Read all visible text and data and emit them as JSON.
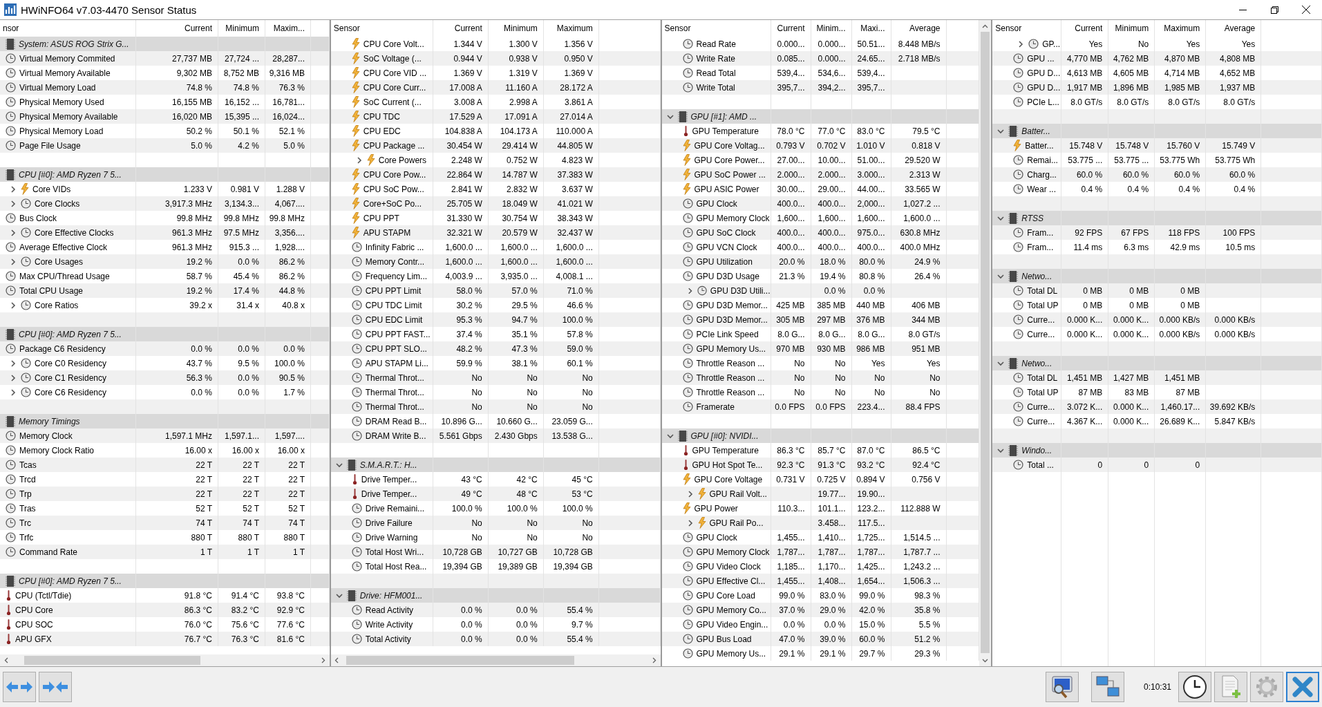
{
  "window": {
    "title": "HWiNFO64 v7.03-4470 Sensor Status"
  },
  "panels": [
    {
      "columns": [
        "nsor",
        "Current",
        "Minimum",
        "Maxim..."
      ],
      "rows": [
        {
          "kind": "group",
          "label": "System: ASUS ROG Strix G..."
        },
        {
          "kind": "clock",
          "label": "Virtual Memory Commited",
          "values": {
            "cur": "27,737 MB",
            "min": "27,724 ...",
            "max": "28,287..."
          }
        },
        {
          "kind": "clock",
          "label": "Virtual Memory Available",
          "values": {
            "cur": "9,302 MB",
            "min": "8,752 MB",
            "max": "9,316 MB"
          }
        },
        {
          "kind": "clock",
          "label": "Virtual Memory Load",
          "values": {
            "cur": "74.8 %",
            "min": "74.8 %",
            "max": "76.3 %"
          }
        },
        {
          "kind": "clock",
          "label": "Physical Memory Used",
          "values": {
            "cur": "16,155 MB",
            "min": "16,152 ...",
            "max": "16,781..."
          }
        },
        {
          "kind": "clock",
          "label": "Physical Memory Available",
          "values": {
            "cur": "16,020 MB",
            "min": "15,395 ...",
            "max": "16,024..."
          }
        },
        {
          "kind": "clock",
          "label": "Physical Memory Load",
          "values": {
            "cur": "50.2 %",
            "min": "50.1 %",
            "max": "52.1 %"
          }
        },
        {
          "kind": "clock",
          "label": "Page File Usage",
          "values": {
            "cur": "5.0 %",
            "min": "4.2 %",
            "max": "5.0 %"
          }
        },
        {
          "kind": "blank"
        },
        {
          "kind": "group",
          "label": "CPU [#0]: AMD Ryzen 7 5..."
        },
        {
          "kind": "bolt",
          "label": "Core VIDs",
          "expanded": false,
          "values": {
            "cur": "1.233 V",
            "min": "0.981 V",
            "max": "1.288 V"
          }
        },
        {
          "kind": "clock",
          "label": "Core Clocks",
          "expanded": false,
          "values": {
            "cur": "3,917.3 MHz",
            "min": "3,134.3...",
            "max": "4,067...."
          }
        },
        {
          "kind": "clock",
          "label": "Bus Clock",
          "values": {
            "cur": "99.8 MHz",
            "min": "99.8 MHz",
            "max": "99.8 MHz"
          }
        },
        {
          "kind": "clock",
          "label": "Core Effective Clocks",
          "expanded": false,
          "values": {
            "cur": "961.3 MHz",
            "min": "97.5 MHz",
            "max": "3,356...."
          }
        },
        {
          "kind": "clock",
          "label": "Average Effective Clock",
          "values": {
            "cur": "961.3 MHz",
            "min": "915.3 ...",
            "max": "1,928...."
          }
        },
        {
          "kind": "clock",
          "label": "Core Usages",
          "expanded": false,
          "values": {
            "cur": "19.2 %",
            "min": "0.0 %",
            "max": "86.2 %"
          }
        },
        {
          "kind": "clock",
          "label": "Max CPU/Thread Usage",
          "values": {
            "cur": "58.7 %",
            "min": "45.4 %",
            "max": "86.2 %"
          }
        },
        {
          "kind": "clock",
          "label": "Total CPU Usage",
          "values": {
            "cur": "19.2 %",
            "min": "17.4 %",
            "max": "44.8 %"
          }
        },
        {
          "kind": "clock",
          "label": "Core Ratios",
          "expanded": false,
          "values": {
            "cur": "39.2 x",
            "min": "31.4 x",
            "max": "40.8 x"
          }
        },
        {
          "kind": "blank"
        },
        {
          "kind": "group",
          "label": "CPU [#0]: AMD Ryzen 7 5..."
        },
        {
          "kind": "clock",
          "label": "Package C6 Residency",
          "values": {
            "cur": "0.0 %",
            "min": "0.0 %",
            "max": "0.0 %"
          }
        },
        {
          "kind": "clock",
          "label": "Core C0 Residency",
          "expanded": false,
          "values": {
            "cur": "43.7 %",
            "min": "9.5 %",
            "max": "100.0 %"
          }
        },
        {
          "kind": "clock",
          "label": "Core C1 Residency",
          "expanded": false,
          "values": {
            "cur": "56.3 %",
            "min": "0.0 %",
            "max": "90.5 %"
          }
        },
        {
          "kind": "clock",
          "label": "Core C6 Residency",
          "expanded": false,
          "values": {
            "cur": "0.0 %",
            "min": "0.0 %",
            "max": "1.7 %"
          }
        },
        {
          "kind": "blank"
        },
        {
          "kind": "group",
          "label": "Memory Timings"
        },
        {
          "kind": "clock",
          "label": "Memory Clock",
          "values": {
            "cur": "1,597.1 MHz",
            "min": "1,597.1...",
            "max": "1,597...."
          }
        },
        {
          "kind": "clock",
          "label": "Memory Clock Ratio",
          "values": {
            "cur": "16.00 x",
            "min": "16.00 x",
            "max": "16.00 x"
          }
        },
        {
          "kind": "clock",
          "label": "Tcas",
          "values": {
            "cur": "22 T",
            "min": "22 T",
            "max": "22 T"
          }
        },
        {
          "kind": "clock",
          "label": "Trcd",
          "values": {
            "cur": "22 T",
            "min": "22 T",
            "max": "22 T"
          }
        },
        {
          "kind": "clock",
          "label": "Trp",
          "values": {
            "cur": "22 T",
            "min": "22 T",
            "max": "22 T"
          }
        },
        {
          "kind": "clock",
          "label": "Tras",
          "values": {
            "cur": "52 T",
            "min": "52 T",
            "max": "52 T"
          }
        },
        {
          "kind": "clock",
          "label": "Trc",
          "values": {
            "cur": "74 T",
            "min": "74 T",
            "max": "74 T"
          }
        },
        {
          "kind": "clock",
          "label": "Trfc",
          "values": {
            "cur": "880 T",
            "min": "880 T",
            "max": "880 T"
          }
        },
        {
          "kind": "clock",
          "label": "Command Rate",
          "values": {
            "cur": "1 T",
            "min": "1 T",
            "max": "1 T"
          }
        },
        {
          "kind": "blank"
        },
        {
          "kind": "group",
          "label": "CPU [#0]: AMD Ryzen 7 5..."
        },
        {
          "kind": "thermometer",
          "label": "CPU (Tctl/Tdie)",
          "values": {
            "cur": "91.8 °C",
            "min": "91.4 °C",
            "max": "93.8 °C"
          }
        },
        {
          "kind": "thermometer",
          "label": "CPU Core",
          "values": {
            "cur": "86.3 °C",
            "min": "83.2 °C",
            "max": "92.9 °C"
          }
        },
        {
          "kind": "thermometer",
          "label": "CPU SOC",
          "values": {
            "cur": "76.0 °C",
            "min": "75.6 °C",
            "max": "77.6 °C"
          }
        },
        {
          "kind": "thermometer",
          "label": "APU GFX",
          "values": {
            "cur": "76.7 °C",
            "min": "76.3 °C",
            "max": "81.6 °C"
          }
        }
      ]
    },
    {
      "columns": [
        "Sensor",
        "Current",
        "Minimum",
        "Maximum"
      ],
      "rows": [
        {
          "kind": "bolt",
          "label": "CPU Core Volt...",
          "values": {
            "cur": "1.344 V",
            "min": "1.300 V",
            "max": "1.356 V"
          }
        },
        {
          "kind": "bolt",
          "label": "SoC Voltage (...",
          "values": {
            "cur": "0.944 V",
            "min": "0.938 V",
            "max": "0.950 V"
          }
        },
        {
          "kind": "bolt",
          "label": "CPU Core VID ...",
          "values": {
            "cur": "1.369 V",
            "min": "1.319 V",
            "max": "1.369 V"
          }
        },
        {
          "kind": "bolt",
          "label": "CPU Core Curr...",
          "values": {
            "cur": "17.008 A",
            "min": "11.160 A",
            "max": "28.172 A"
          }
        },
        {
          "kind": "bolt",
          "label": "SoC Current (...",
          "values": {
            "cur": "3.008 A",
            "min": "2.998 A",
            "max": "3.861 A"
          }
        },
        {
          "kind": "bolt",
          "label": "CPU TDC",
          "values": {
            "cur": "17.529 A",
            "min": "17.091 A",
            "max": "27.014 A"
          }
        },
        {
          "kind": "bolt",
          "label": "CPU EDC",
          "values": {
            "cur": "104.838 A",
            "min": "104.173 A",
            "max": "110.000 A"
          }
        },
        {
          "kind": "bolt",
          "label": "CPU Package ...",
          "values": {
            "cur": "30.454 W",
            "min": "29.414 W",
            "max": "44.805 W"
          }
        },
        {
          "kind": "bolt",
          "label": "Core Powers",
          "expanded": false,
          "values": {
            "cur": "2.248 W",
            "min": "0.752 W",
            "max": "4.823 W"
          }
        },
        {
          "kind": "bolt",
          "label": "CPU Core Pow...",
          "values": {
            "cur": "22.864 W",
            "min": "14.787 W",
            "max": "37.383 W"
          }
        },
        {
          "kind": "bolt",
          "label": "CPU SoC Pow...",
          "values": {
            "cur": "2.841 W",
            "min": "2.832 W",
            "max": "3.637 W"
          }
        },
        {
          "kind": "bolt",
          "label": "Core+SoC Po...",
          "values": {
            "cur": "25.705 W",
            "min": "18.049 W",
            "max": "41.021 W"
          }
        },
        {
          "kind": "bolt",
          "label": "CPU PPT",
          "values": {
            "cur": "31.330 W",
            "min": "30.754 W",
            "max": "38.343 W"
          }
        },
        {
          "kind": "bolt",
          "label": "APU STAPM",
          "values": {
            "cur": "32.321 W",
            "min": "20.579 W",
            "max": "32.437 W"
          }
        },
        {
          "kind": "clock",
          "label": "Infinity Fabric ...",
          "values": {
            "cur": "1,600.0 ...",
            "min": "1,600.0 ...",
            "max": "1,600.0 ..."
          }
        },
        {
          "kind": "clock",
          "label": "Memory Contr...",
          "values": {
            "cur": "1,600.0 ...",
            "min": "1,600.0 ...",
            "max": "1,600.0 ..."
          }
        },
        {
          "kind": "clock",
          "label": "Frequency Lim...",
          "values": {
            "cur": "4,003.9 ...",
            "min": "3,935.0 ...",
            "max": "4,008.1 ..."
          }
        },
        {
          "kind": "clock",
          "label": "CPU PPT Limit",
          "values": {
            "cur": "58.0 %",
            "min": "57.0 %",
            "max": "71.0 %"
          }
        },
        {
          "kind": "clock",
          "label": "CPU TDC Limit",
          "values": {
            "cur": "30.2 %",
            "min": "29.5 %",
            "max": "46.6 %"
          }
        },
        {
          "kind": "clock",
          "label": "CPU EDC Limit",
          "values": {
            "cur": "95.3 %",
            "min": "94.7 %",
            "max": "100.0 %"
          }
        },
        {
          "kind": "clock",
          "label": "CPU PPT FAST...",
          "values": {
            "cur": "37.4 %",
            "min": "35.1 %",
            "max": "57.8 %"
          }
        },
        {
          "kind": "clock",
          "label": "CPU PPT SLO...",
          "values": {
            "cur": "48.2 %",
            "min": "47.3 %",
            "max": "59.0 %"
          }
        },
        {
          "kind": "clock",
          "label": "APU STAPM Li...",
          "values": {
            "cur": "59.9 %",
            "min": "38.1 %",
            "max": "60.1 %"
          }
        },
        {
          "kind": "clock",
          "label": "Thermal Throt...",
          "values": {
            "cur": "No",
            "min": "No",
            "max": "No"
          }
        },
        {
          "kind": "clock",
          "label": "Thermal Throt...",
          "values": {
            "cur": "No",
            "min": "No",
            "max": "No"
          }
        },
        {
          "kind": "clock",
          "label": "Thermal Throt...",
          "values": {
            "cur": "No",
            "min": "No",
            "max": "No"
          }
        },
        {
          "kind": "clock",
          "label": "DRAM Read B...",
          "values": {
            "cur": "10.896 G...",
            "min": "10.660 G...",
            "max": "23.059 G..."
          }
        },
        {
          "kind": "clock",
          "label": "DRAM Write B...",
          "values": {
            "cur": "5.561 Gbps",
            "min": "2.430 Gbps",
            "max": "13.538 G..."
          }
        },
        {
          "kind": "blank"
        },
        {
          "kind": "group",
          "label": "S.M.A.R.T.: H...",
          "expanded": true
        },
        {
          "kind": "thermometer",
          "label": "Drive Temper...",
          "values": {
            "cur": "43 °C",
            "min": "42 °C",
            "max": "45 °C"
          }
        },
        {
          "kind": "thermometer",
          "label": "Drive Temper...",
          "values": {
            "cur": "49 °C",
            "min": "48 °C",
            "max": "53 °C"
          }
        },
        {
          "kind": "clock",
          "label": "Drive Remaini...",
          "values": {
            "cur": "100.0 %",
            "min": "100.0 %",
            "max": "100.0 %"
          }
        },
        {
          "kind": "clock",
          "label": "Drive Failure",
          "values": {
            "cur": "No",
            "min": "No",
            "max": "No"
          }
        },
        {
          "kind": "clock",
          "label": "Drive Warning",
          "values": {
            "cur": "No",
            "min": "No",
            "max": "No"
          }
        },
        {
          "kind": "clock",
          "label": "Total Host Wri...",
          "values": {
            "cur": "10,728 GB",
            "min": "10,727 GB",
            "max": "10,728 GB"
          }
        },
        {
          "kind": "clock",
          "label": "Total Host Rea...",
          "values": {
            "cur": "19,394 GB",
            "min": "19,389 GB",
            "max": "19,394 GB"
          }
        },
        {
          "kind": "blank"
        },
        {
          "kind": "group",
          "label": "Drive: HFM001...",
          "expanded": true
        },
        {
          "kind": "clock",
          "label": "Read Activity",
          "values": {
            "cur": "0.0 %",
            "min": "0.0 %",
            "max": "55.4 %"
          }
        },
        {
          "kind": "clock",
          "label": "Write Activity",
          "values": {
            "cur": "0.0 %",
            "min": "0.0 %",
            "max": "9.7 %"
          }
        },
        {
          "kind": "clock",
          "label": "Total Activity",
          "values": {
            "cur": "0.0 %",
            "min": "0.0 %",
            "max": "55.4 %"
          }
        }
      ]
    },
    {
      "columns": [
        "Sensor",
        "Current",
        "Minim...",
        "Maxi...",
        "Average"
      ],
      "rows": [
        {
          "kind": "clock",
          "label": "Read Rate",
          "values": {
            "cur": "0.000...",
            "min": "0.000...",
            "max": "50.51...",
            "avg": "8.448 MB/s"
          }
        },
        {
          "kind": "clock",
          "label": "Write Rate",
          "values": {
            "cur": "0.085...",
            "min": "0.000...",
            "max": "24.65...",
            "avg": "2.718 MB/s"
          }
        },
        {
          "kind": "clock",
          "label": "Read Total",
          "values": {
            "cur": "539,4...",
            "min": "534,6...",
            "max": "539,4..."
          }
        },
        {
          "kind": "clock",
          "label": "Write Total",
          "values": {
            "cur": "395,7...",
            "min": "394,2...",
            "max": "395,7..."
          }
        },
        {
          "kind": "blank"
        },
        {
          "kind": "group",
          "label": "GPU [#1]: AMD ...",
          "expanded": true
        },
        {
          "kind": "thermometer",
          "label": "GPU Temperature",
          "values": {
            "cur": "78.0 °C",
            "min": "77.0 °C",
            "max": "83.0 °C",
            "avg": "79.5 °C"
          }
        },
        {
          "kind": "bolt",
          "label": "GPU Core Voltag...",
          "values": {
            "cur": "0.793 V",
            "min": "0.702 V",
            "max": "1.010 V",
            "avg": "0.818 V"
          }
        },
        {
          "kind": "bolt",
          "label": "GPU Core Power...",
          "values": {
            "cur": "27.00...",
            "min": "10.00...",
            "max": "51.00...",
            "avg": "29.520 W"
          }
        },
        {
          "kind": "bolt",
          "label": "GPU SoC Power ...",
          "values": {
            "cur": "2.000...",
            "min": "2.000...",
            "max": "3.000...",
            "avg": "2.313 W"
          }
        },
        {
          "kind": "bolt",
          "label": "GPU ASIC Power",
          "values": {
            "cur": "30.00...",
            "min": "29.00...",
            "max": "44.00...",
            "avg": "33.565 W"
          }
        },
        {
          "kind": "clock",
          "label": "GPU Clock",
          "values": {
            "cur": "400.0...",
            "min": "400.0...",
            "max": "2,000...",
            "avg": "1,027.2 ..."
          }
        },
        {
          "kind": "clock",
          "label": "GPU Memory Clock",
          "values": {
            "cur": "1,600...",
            "min": "1,600...",
            "max": "1,600...",
            "avg": "1,600.0 ..."
          }
        },
        {
          "kind": "clock",
          "label": "GPU SoC Clock",
          "values": {
            "cur": "400.0...",
            "min": "400.0...",
            "max": "975.0...",
            "avg": "630.8 MHz"
          }
        },
        {
          "kind": "clock",
          "label": "GPU VCN Clock",
          "values": {
            "cur": "400.0...",
            "min": "400.0...",
            "max": "400.0...",
            "avg": "400.0 MHz"
          }
        },
        {
          "kind": "clock",
          "label": "GPU Utilization",
          "values": {
            "cur": "20.0 %",
            "min": "18.0 %",
            "max": "80.0 %",
            "avg": "24.9 %"
          }
        },
        {
          "kind": "clock",
          "label": "GPU D3D Usage",
          "values": {
            "cur": "21.3 %",
            "min": "19.4 %",
            "max": "80.8 %",
            "avg": "26.4 %"
          }
        },
        {
          "kind": "clock",
          "label": "GPU D3D Utili...",
          "expanded": false,
          "values": {
            "min": "0.0 %",
            "max": "0.0 %"
          }
        },
        {
          "kind": "clock",
          "label": "GPU D3D Memor...",
          "values": {
            "cur": "425 MB",
            "min": "385 MB",
            "max": "440 MB",
            "avg": "406 MB"
          }
        },
        {
          "kind": "clock",
          "label": "GPU D3D Memor...",
          "values": {
            "cur": "305 MB",
            "min": "297 MB",
            "max": "376 MB",
            "avg": "344 MB"
          }
        },
        {
          "kind": "clock",
          "label": "PCIe Link Speed",
          "values": {
            "cur": "8.0 G...",
            "min": "8.0 G...",
            "max": "8.0 G...",
            "avg": "8.0 GT/s"
          }
        },
        {
          "kind": "clock",
          "label": "GPU Memory Us...",
          "values": {
            "cur": "970 MB",
            "min": "930 MB",
            "max": "986 MB",
            "avg": "951 MB"
          }
        },
        {
          "kind": "clock",
          "label": "Throttle Reason ...",
          "values": {
            "cur": "No",
            "min": "No",
            "max": "Yes",
            "avg": "Yes"
          }
        },
        {
          "kind": "clock",
          "label": "Throttle Reason ...",
          "values": {
            "cur": "No",
            "min": "No",
            "max": "No",
            "avg": "No"
          }
        },
        {
          "kind": "clock",
          "label": "Throttle Reason ...",
          "values": {
            "cur": "No",
            "min": "No",
            "max": "No",
            "avg": "No"
          }
        },
        {
          "kind": "clock",
          "label": "Framerate",
          "values": {
            "cur": "0.0 FPS",
            "min": "0.0 FPS",
            "max": "223.4...",
            "avg": "88.4 FPS"
          }
        },
        {
          "kind": "blank"
        },
        {
          "kind": "group",
          "label": "GPU [#0]: NVIDI...",
          "expanded": true
        },
        {
          "kind": "thermometer",
          "label": "GPU Temperature",
          "values": {
            "cur": "86.3 °C",
            "min": "85.7 °C",
            "max": "87.0 °C",
            "avg": "86.5 °C"
          }
        },
        {
          "kind": "thermometer",
          "label": "GPU Hot Spot Te...",
          "values": {
            "cur": "92.3 °C",
            "min": "91.3 °C",
            "max": "93.2 °C",
            "avg": "92.4 °C"
          }
        },
        {
          "kind": "bolt",
          "label": "GPU Core Voltage",
          "values": {
            "cur": "0.731 V",
            "min": "0.725 V",
            "max": "0.894 V",
            "avg": "0.756 V"
          }
        },
        {
          "kind": "bolt",
          "label": "GPU Rail Volt...",
          "expanded": false,
          "values": {
            "min": "19.77...",
            "max": "19.90..."
          }
        },
        {
          "kind": "bolt",
          "label": "GPU Power",
          "values": {
            "cur": "110.3...",
            "min": "101.1...",
            "max": "123.2...",
            "avg": "112.888 W"
          }
        },
        {
          "kind": "bolt",
          "label": "GPU Rail Po...",
          "expanded": false,
          "values": {
            "min": "3.458...",
            "max": "117.5..."
          }
        },
        {
          "kind": "clock",
          "label": "GPU Clock",
          "values": {
            "cur": "1,455...",
            "min": "1,410...",
            "max": "1,725...",
            "avg": "1,514.5 ..."
          }
        },
        {
          "kind": "clock",
          "label": "GPU Memory Clock",
          "values": {
            "cur": "1,787...",
            "min": "1,787...",
            "max": "1,787...",
            "avg": "1,787.7 ..."
          }
        },
        {
          "kind": "clock",
          "label": "GPU Video Clock",
          "values": {
            "cur": "1,185...",
            "min": "1,170...",
            "max": "1,425...",
            "avg": "1,243.2 ..."
          }
        },
        {
          "kind": "clock",
          "label": "GPU Effective Cl...",
          "values": {
            "cur": "1,455...",
            "min": "1,408...",
            "max": "1,654...",
            "avg": "1,506.3 ..."
          }
        },
        {
          "kind": "clock",
          "label": "GPU Core Load",
          "values": {
            "cur": "99.0 %",
            "min": "83.0 %",
            "max": "99.0 %",
            "avg": "98.3 %"
          }
        },
        {
          "kind": "clock",
          "label": "GPU Memory Co...",
          "values": {
            "cur": "37.0 %",
            "min": "29.0 %",
            "max": "42.0 %",
            "avg": "35.8 %"
          }
        },
        {
          "kind": "clock",
          "label": "GPU Video Engin...",
          "values": {
            "cur": "0.0 %",
            "min": "0.0 %",
            "max": "15.0 %",
            "avg": "5.5 %"
          }
        },
        {
          "kind": "clock",
          "label": "GPU Bus Load",
          "values": {
            "cur": "47.0 %",
            "min": "39.0 %",
            "max": "60.0 %",
            "avg": "51.2 %"
          }
        },
        {
          "kind": "clock",
          "label": "GPU Memory Us...",
          "values": {
            "cur": "29.1 %",
            "min": "29.1 %",
            "max": "29.7 %",
            "avg": "29.3 %"
          }
        }
      ]
    },
    {
      "columns": [
        "Sensor",
        "Current",
        "Minimum",
        "Maximum",
        "Average"
      ],
      "rows": [
        {
          "kind": "clock",
          "label": "GP...",
          "expanded": false,
          "values": {
            "cur": "Yes",
            "min": "No",
            "max": "Yes",
            "avg": "Yes"
          }
        },
        {
          "kind": "clock",
          "label": "GPU ...",
          "values": {
            "cur": "4,770 MB",
            "min": "4,762 MB",
            "max": "4,870 MB",
            "avg": "4,808 MB"
          }
        },
        {
          "kind": "clock",
          "label": "GPU D...",
          "values": {
            "cur": "4,613 MB",
            "min": "4,605 MB",
            "max": "4,714 MB",
            "avg": "4,652 MB"
          }
        },
        {
          "kind": "clock",
          "label": "GPU D...",
          "values": {
            "cur": "1,917 MB",
            "min": "1,896 MB",
            "max": "1,985 MB",
            "avg": "1,937 MB"
          }
        },
        {
          "kind": "clock",
          "label": "PCIe L...",
          "values": {
            "cur": "8.0 GT/s",
            "min": "8.0 GT/s",
            "max": "8.0 GT/s",
            "avg": "8.0 GT/s"
          }
        },
        {
          "kind": "blank"
        },
        {
          "kind": "group",
          "label": "Batter...",
          "expanded": true
        },
        {
          "kind": "bolt",
          "label": "Batter...",
          "values": {
            "cur": "15.748 V",
            "min": "15.748 V",
            "max": "15.760 V",
            "avg": "15.749 V"
          }
        },
        {
          "kind": "clock",
          "label": "Remai...",
          "values": {
            "cur": "53.775 ...",
            "min": "53.775 ...",
            "max": "53.775 Wh",
            "avg": "53.775 Wh"
          }
        },
        {
          "kind": "clock",
          "label": "Charg...",
          "values": {
            "cur": "60.0 %",
            "min": "60.0 %",
            "max": "60.0 %",
            "avg": "60.0 %"
          }
        },
        {
          "kind": "clock",
          "label": "Wear ...",
          "values": {
            "cur": "0.4 %",
            "min": "0.4 %",
            "max": "0.4 %",
            "avg": "0.4 %"
          }
        },
        {
          "kind": "blank"
        },
        {
          "kind": "group",
          "label": "RTSS",
          "expanded": true
        },
        {
          "kind": "clock",
          "label": "Fram...",
          "values": {
            "cur": "92 FPS",
            "min": "67 FPS",
            "max": "118 FPS",
            "avg": "100 FPS"
          }
        },
        {
          "kind": "clock",
          "label": "Fram...",
          "values": {
            "cur": "11.4 ms",
            "min": "6.3 ms",
            "max": "42.9 ms",
            "avg": "10.5 ms"
          }
        },
        {
          "kind": "blank"
        },
        {
          "kind": "group",
          "label": "Netwo...",
          "expanded": true
        },
        {
          "kind": "clock",
          "label": "Total DL",
          "values": {
            "cur": "0 MB",
            "min": "0 MB",
            "max": "0 MB"
          }
        },
        {
          "kind": "clock",
          "label": "Total UP",
          "values": {
            "cur": "0 MB",
            "min": "0 MB",
            "max": "0 MB"
          }
        },
        {
          "kind": "clock",
          "label": "Curre...",
          "values": {
            "cur": "0.000 K...",
            "min": "0.000 K...",
            "max": "0.000 KB/s",
            "avg": "0.000 KB/s"
          }
        },
        {
          "kind": "clock",
          "label": "Curre...",
          "values": {
            "cur": "0.000 K...",
            "min": "0.000 K...",
            "max": "0.000 KB/s",
            "avg": "0.000 KB/s"
          }
        },
        {
          "kind": "blank"
        },
        {
          "kind": "group",
          "label": "Netwo...",
          "expanded": true
        },
        {
          "kind": "clock",
          "label": "Total DL",
          "values": {
            "cur": "1,451 MB",
            "min": "1,427 MB",
            "max": "1,451 MB"
          }
        },
        {
          "kind": "clock",
          "label": "Total UP",
          "values": {
            "cur": "87 MB",
            "min": "83 MB",
            "max": "87 MB"
          }
        },
        {
          "kind": "clock",
          "label": "Curre...",
          "values": {
            "cur": "3.072 K...",
            "min": "0.000 K...",
            "max": "1,460.17...",
            "avg": "39.692 KB/s"
          }
        },
        {
          "kind": "clock",
          "label": "Curre...",
          "values": {
            "cur": "4.367 K...",
            "min": "0.000 K...",
            "max": "26.689 K...",
            "avg": "5.847 KB/s"
          }
        },
        {
          "kind": "blank"
        },
        {
          "kind": "group",
          "label": "Windo...",
          "expanded": true
        },
        {
          "kind": "clock",
          "label": "Total ...",
          "values": {
            "cur": "0",
            "min": "0",
            "max": "0"
          }
        }
      ]
    }
  ],
  "toolbar": {
    "nav_buttons": [
      {
        "kind": "expand"
      },
      {
        "kind": "collapse"
      }
    ],
    "tool_buttons": [
      {
        "kind": "monitor"
      },
      {
        "kind": "network"
      }
    ],
    "timer": "0:10:31",
    "action_buttons": [
      {
        "kind": "clock",
        "focused": false
      },
      {
        "kind": "report",
        "focused": false
      },
      {
        "kind": "settings",
        "focused": false
      },
      {
        "kind": "close",
        "focused": true
      }
    ]
  }
}
